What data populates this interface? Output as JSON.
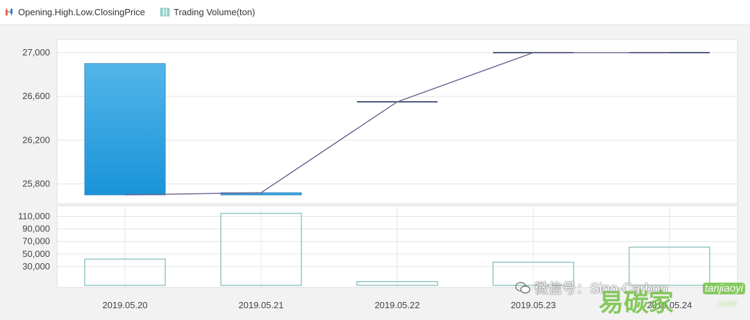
{
  "legend": {
    "items": [
      {
        "label": "Opening.High.Low.ClosingPrice",
        "icon": "candlestick-icon",
        "color": "#2f7fd6"
      },
      {
        "label": "Trading Volume(ton)",
        "icon": "volume-bars-icon",
        "color": "#7ecac6"
      }
    ]
  },
  "chart_data": [
    {
      "type": "candlestick",
      "title": "",
      "x": [
        "2019.05.20",
        "2019.05.21",
        "2019.05.22",
        "2019.05.23",
        "2019.05.24"
      ],
      "series": [
        {
          "name": "Opening.High.Low.ClosingPrice",
          "open": [
            25700,
            25700,
            26550,
            27000,
            27000
          ],
          "close": [
            26900,
            25720,
            26550,
            27000,
            27000
          ],
          "high": [
            26900,
            25720,
            26550,
            27000,
            27000
          ],
          "low": [
            25700,
            25700,
            26550,
            27000,
            27000
          ]
        },
        {
          "name": "close-line",
          "values": [
            25700,
            25720,
            26550,
            27000,
            27000
          ]
        }
      ],
      "yticks": [
        25800,
        26200,
        26600,
        27000
      ],
      "yticklabels": [
        "25,800",
        "26,200",
        "26,600",
        "27,000"
      ],
      "ylim": [
        25620,
        27120
      ],
      "grid": true,
      "colors": {
        "box_top": "#52b6ea",
        "box_bottom": "#1a93d8",
        "box_stroke": "#3a8cc4",
        "line": "#6e6a96"
      }
    },
    {
      "type": "bar",
      "title": "",
      "categories": [
        "2019.05.20",
        "2019.05.21",
        "2019.05.22",
        "2019.05.23",
        "2019.05.24"
      ],
      "series": [
        {
          "name": "Trading Volume(ton)",
          "values": [
            42000,
            115000,
            6000,
            37000,
            61000
          ]
        }
      ],
      "yticks": [
        30000,
        50000,
        70000,
        90000,
        110000
      ],
      "yticklabels": [
        "30,000",
        "50,000",
        "70,000",
        "90,000",
        "110,000"
      ],
      "ylim": [
        0,
        125000
      ],
      "grid": true,
      "colors": {
        "bar_stroke": "#7ab8b6",
        "bar_fill": "#ffffff"
      }
    }
  ],
  "watermark": {
    "wechat": "微信号：Sino-Carbon",
    "logo_cn": "易碳家",
    "logo_en": "tanjiaoyi",
    "logo_dom": ".com"
  }
}
